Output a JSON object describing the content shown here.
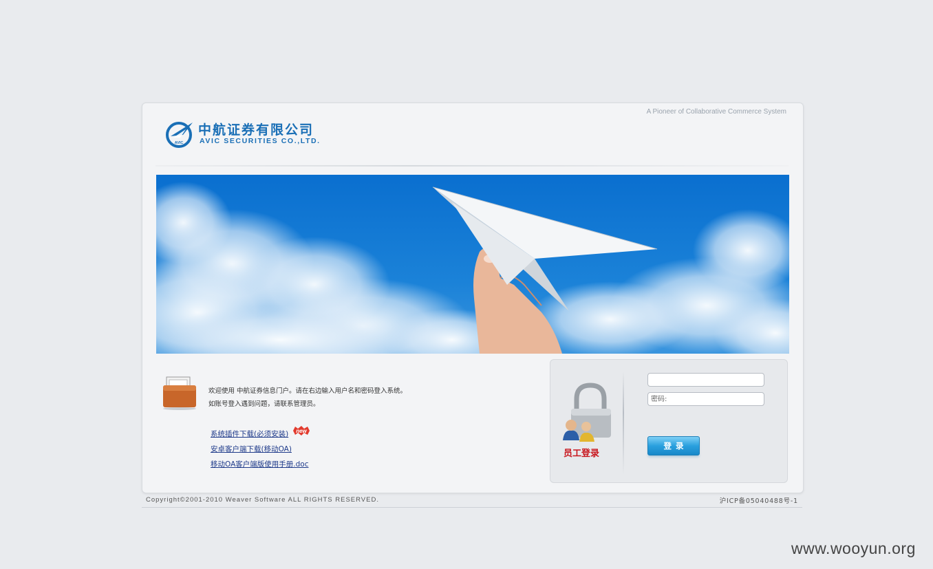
{
  "header": {
    "tagline": "A Pioneer of Collaborative Commerce System",
    "company_cn": "中航证券有限公司",
    "company_en": "AVIC SECURITIES CO.,LTD.",
    "logo_mark": "AVIC"
  },
  "intro": {
    "line1": "欢迎使用 中航证券信息门户。请在右边输入用户名和密码登入系统。",
    "line2": "如账号登入遇到问题，请联系管理员。"
  },
  "links": [
    {
      "label": "系统插件下载(必须安装)",
      "badge": "new"
    },
    {
      "label": "安卓客户端下载(移动OA)"
    },
    {
      "label": "移动OA客户端版使用手册.doc"
    }
  ],
  "login": {
    "label": "员工登录",
    "username_value": "",
    "password_placeholder": "密码:",
    "button": "登录"
  },
  "footer": {
    "copyright": "Copyright©2001-2010 Weaver Software ALL RIGHTS RESERVED.",
    "icp": "沪ICP备05040488号-1"
  },
  "watermark": "www.wooyun.org",
  "colors": {
    "brand_blue": "#1a6fb6",
    "login_label_red": "#c8161d",
    "button_blue": "#2aa0de",
    "link_blue": "#1e3a8a"
  }
}
